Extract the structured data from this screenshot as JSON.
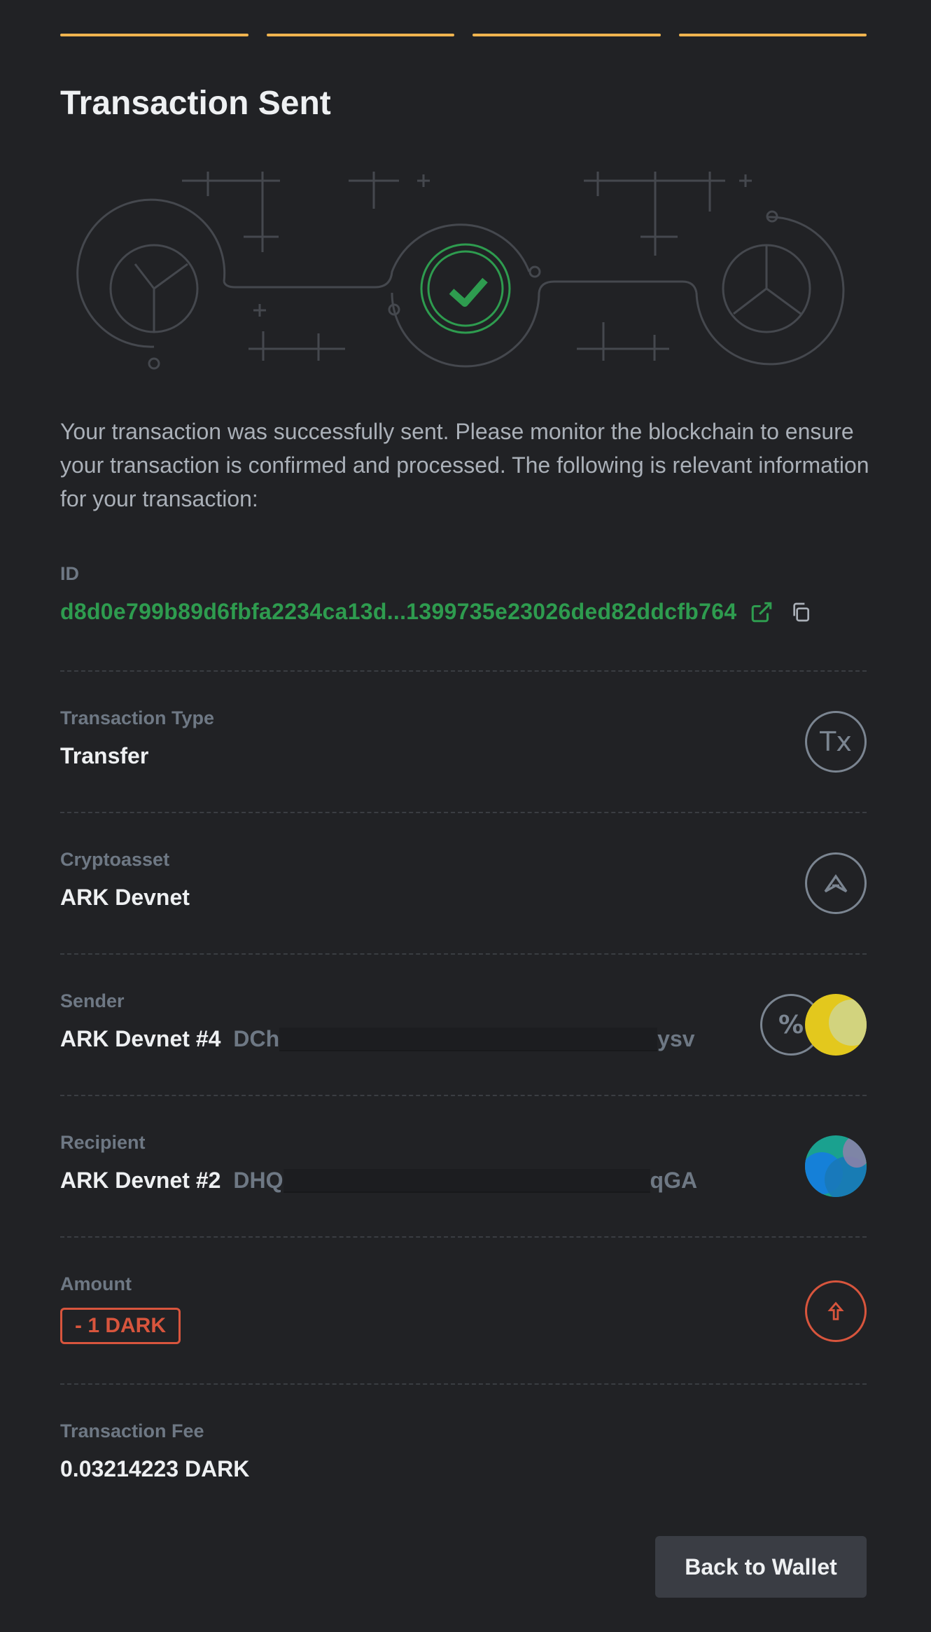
{
  "progress": {
    "steps_total": 4,
    "steps_completed": 4,
    "color": "#f0b44f"
  },
  "title": "Transaction Sent",
  "description": "Your transaction was successfully sent. Please monitor the blockchain to ensure your transaction is confirmed and processed. The following is relevant information for your transaction:",
  "id": {
    "label": "ID",
    "value": "d8d0e799b89d6fbfa2234ca13d...1399735e23026ded82ddcfb764",
    "link_icon": "external-link-icon",
    "copy_icon": "copy-icon",
    "color": "#2e9c4f"
  },
  "transaction_type": {
    "label": "Transaction Type",
    "value": "Transfer",
    "icon": "tx-icon",
    "icon_text": "Tx"
  },
  "cryptoasset": {
    "label": "Cryptoasset",
    "value": "ARK Devnet",
    "icon": "ark-logo-icon"
  },
  "sender": {
    "label": "Sender",
    "name": "ARK Devnet #4",
    "address_start": "DCh",
    "address_end": "ysv",
    "icon": "percent-icon"
  },
  "recipient": {
    "label": "Recipient",
    "name": "ARK Devnet #2",
    "address_start": "DHQ",
    "address_end": "qGA"
  },
  "amount": {
    "label": "Amount",
    "value": "- 1 DARK",
    "icon": "sent-arrow-icon",
    "color": "#d8553d"
  },
  "fee": {
    "label": "Transaction Fee",
    "value": "0.03214223 DARK"
  },
  "back_button": "Back to Wallet"
}
